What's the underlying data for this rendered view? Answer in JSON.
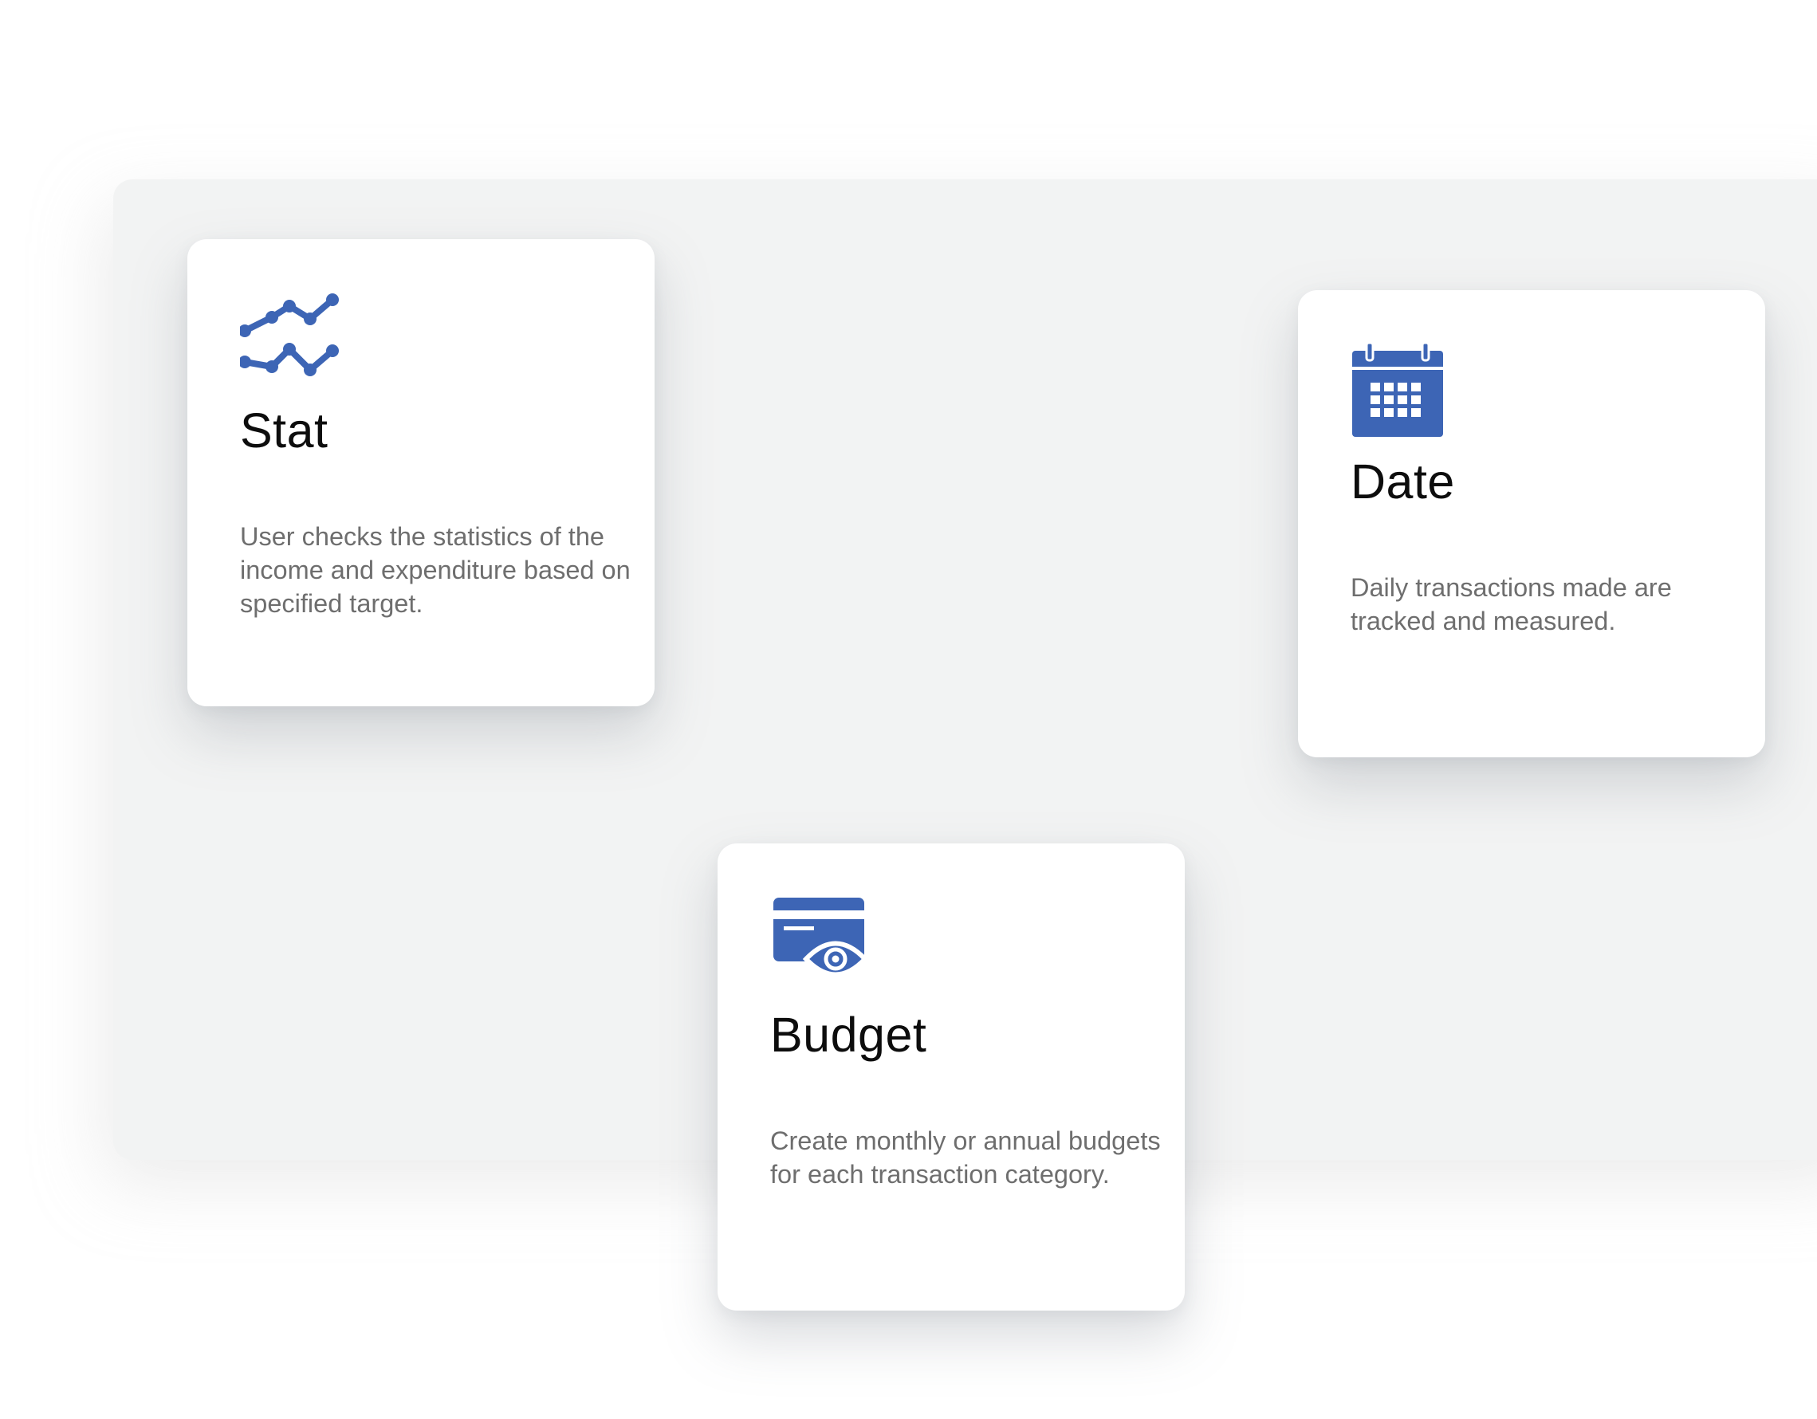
{
  "colors": {
    "accent": "#3d65b5",
    "panel_background": "#f2f3f3",
    "card_background": "#ffffff",
    "title_text": "#0d0d0d",
    "description_text": "#6e6e6e"
  },
  "cards": [
    {
      "icon": "stats-line-chart-icon",
      "title": "Stat",
      "description": "User checks the statistics of the income and expenditure based on specified target."
    },
    {
      "icon": "calendar-icon",
      "title": "Date",
      "description": "Daily transactions made are tracked and measured."
    },
    {
      "icon": "credit-card-eye-icon",
      "title": "Budget",
      "description": "Create monthly or annual budgets for each transaction category."
    }
  ]
}
